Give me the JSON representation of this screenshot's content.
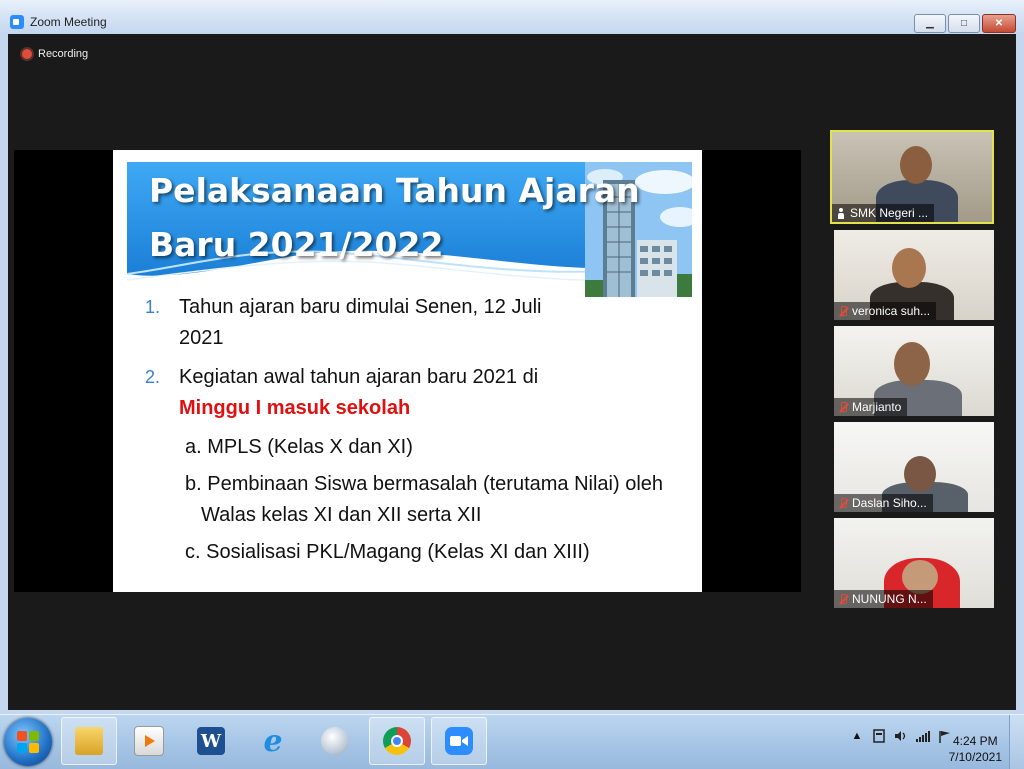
{
  "window": {
    "title": "Zoom Meeting",
    "minimize_label": "▁",
    "maximize_label": "□",
    "close_label": "✕"
  },
  "recording": {
    "label": "Recording"
  },
  "slide": {
    "title_line1": "Pelaksanaan Tahun Ajaran",
    "title_line2": "Baru 2021/2022",
    "items": [
      {
        "num": "1.",
        "text_a": "Tahun ajaran baru dimulai Senen, 12 Juli",
        "text_b": "2021"
      },
      {
        "num": "2.",
        "text_a": "Kegiatan awal tahun ajaran baru 2021 di",
        "highlight": "Minggu I masuk sekolah"
      }
    ],
    "subitems": [
      "a. MPLS (Kelas X dan XI)",
      "b. Pembinaan Siswa bermasalah (terutama Nilai) oleh Walas kelas XI dan XII serta XII",
      "c. Sosialisasi PKL/Magang (Kelas XI dan XIII)"
    ]
  },
  "participants": [
    {
      "name": "SMK Negeri ...",
      "active": true,
      "muted": false
    },
    {
      "name": "veronica suh...",
      "active": false,
      "muted": true
    },
    {
      "name": "Marjianto",
      "active": false,
      "muted": true
    },
    {
      "name": "Daslan Siho...",
      "active": false,
      "muted": true
    },
    {
      "name": "NUNUNG N...",
      "active": false,
      "muted": true
    }
  ],
  "taskbar": {
    "apps": [
      "explorer-icon",
      "media-player-icon",
      "word-icon",
      "internet-explorer-icon",
      "globe-icon",
      "chrome-icon",
      "zoom-icon"
    ],
    "tray_expand": "▲",
    "time": "4:24 PM",
    "date": "7/10/2021"
  },
  "colors": {
    "accent": "#2d8cff",
    "active_border": "#e4e24a",
    "highlight_text": "#e01010",
    "recording_dot": "#e04b3a"
  }
}
